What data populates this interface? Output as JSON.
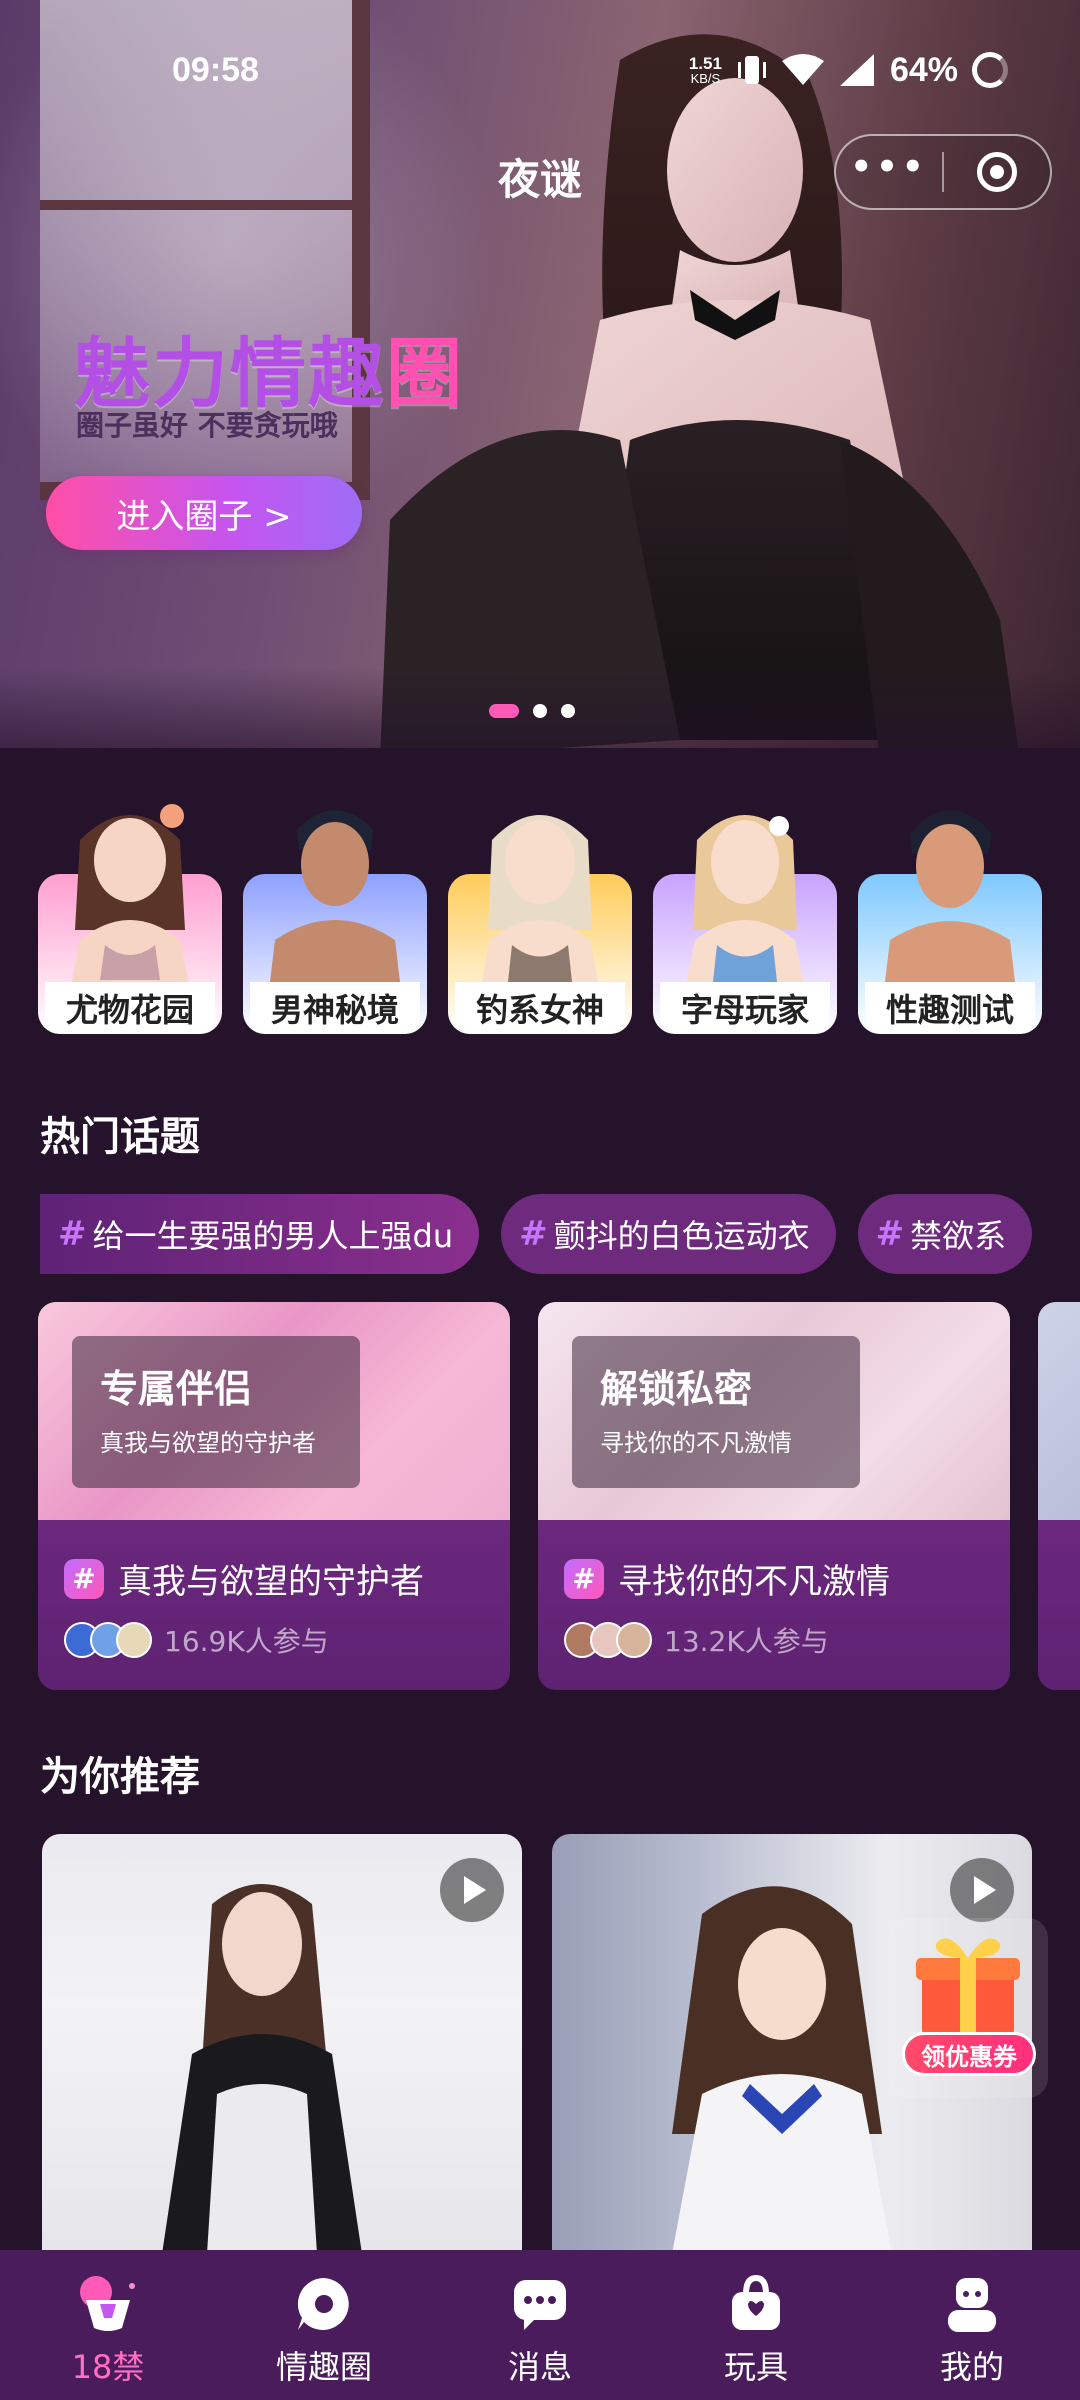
{
  "status_bar": {
    "time": "09:58",
    "net_speed": "1.51",
    "net_unit": "KB/S",
    "battery": "64%"
  },
  "app": {
    "title": "夜谜"
  },
  "hero": {
    "headline_part1": "魅力情趣",
    "headline_part2": "圈",
    "subtitle": "圈子虽好 不要贪玩哦",
    "cta": "进入圈子 >",
    "slide_count": 3,
    "active_slide": 1
  },
  "categories": [
    {
      "label": "尤物花园"
    },
    {
      "label": "男神秘境"
    },
    {
      "label": "钓系女神"
    },
    {
      "label": "字母玩家"
    },
    {
      "label": "性趣测试"
    }
  ],
  "hot_topics": {
    "title": "热门话题",
    "tags": [
      {
        "hash": "#",
        "text": "给一生要强的男人上强du"
      },
      {
        "hash": "#",
        "text": "颤抖的白色运动衣"
      },
      {
        "hash": "#",
        "text": "禁欲系"
      }
    ],
    "cards": [
      {
        "overlay_title": "专属伴侣",
        "overlay_sub": "真我与欲望的守护者",
        "title": "真我与欲望的守护者",
        "participants": "16.9K人参与"
      },
      {
        "overlay_title": "解锁私密",
        "overlay_sub": "寻找你的不凡激情",
        "title": "寻找你的不凡激情",
        "participants": "13.2K人参与"
      }
    ]
  },
  "recommend": {
    "title": "为你推荐",
    "coupon": "领优惠券"
  },
  "tabbar": {
    "items": [
      {
        "label": "18禁",
        "icon": "home-icon",
        "active": true
      },
      {
        "label": "情趣圈",
        "icon": "chat-bubble-icon",
        "active": false
      },
      {
        "label": "消息",
        "icon": "message-icon",
        "active": false
      },
      {
        "label": "玩具",
        "icon": "shopping-bag-icon",
        "active": false
      },
      {
        "label": "我的",
        "icon": "profile-icon",
        "active": false
      }
    ]
  },
  "colors": {
    "background": "#25122b",
    "accent_pink": "#ff5ab8",
    "accent_purple": "#b44fe6",
    "tabbar": "#4a1c5c"
  }
}
